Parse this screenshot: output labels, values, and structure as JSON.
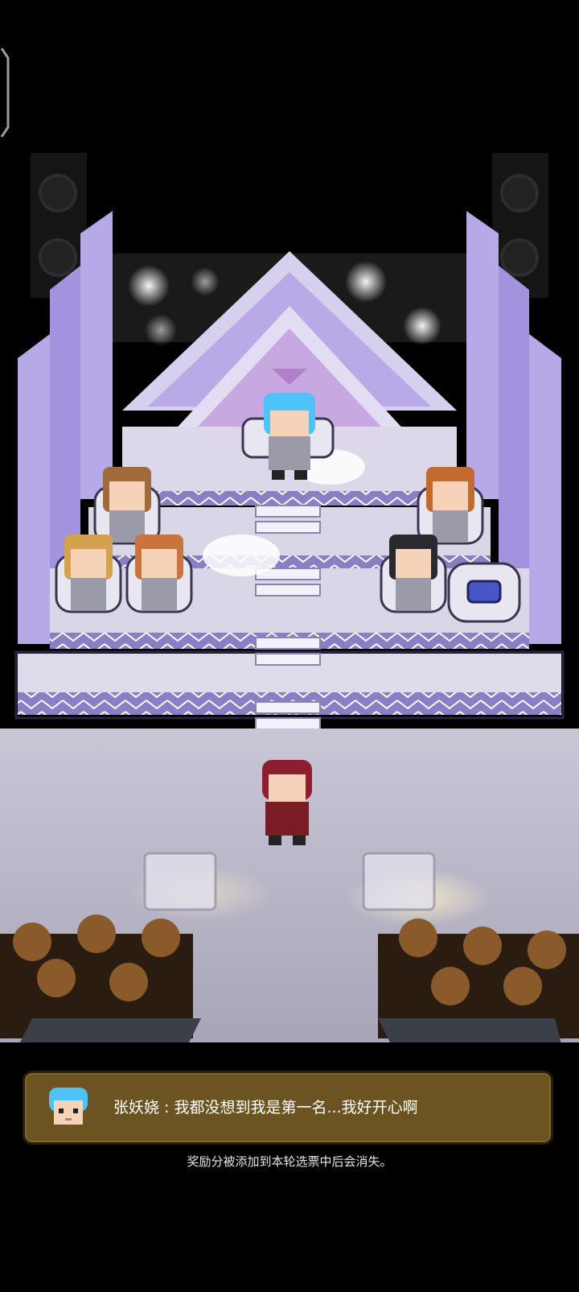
{
  "scene": {
    "description_icons": [
      "spotlight-icon",
      "speaker-icon",
      "trophy-seat-icon"
    ],
    "colors": {
      "stage": "#d9d6e8",
      "stage_side": "#8a7fc4",
      "pillar": "#b7a9e8",
      "floor": "#c9c6d6",
      "dialog_bg": "#6b5421",
      "winner_hair": "#4fc3f7",
      "player_hair": "#8b1e2f",
      "player_coat": "#7a1c24"
    }
  },
  "dialog": {
    "speaker_line": "张妖娆 : 我都没想到我是第一名...我好开心啊"
  },
  "hint": "奖励分被添加到本轮选票中后会消失。"
}
